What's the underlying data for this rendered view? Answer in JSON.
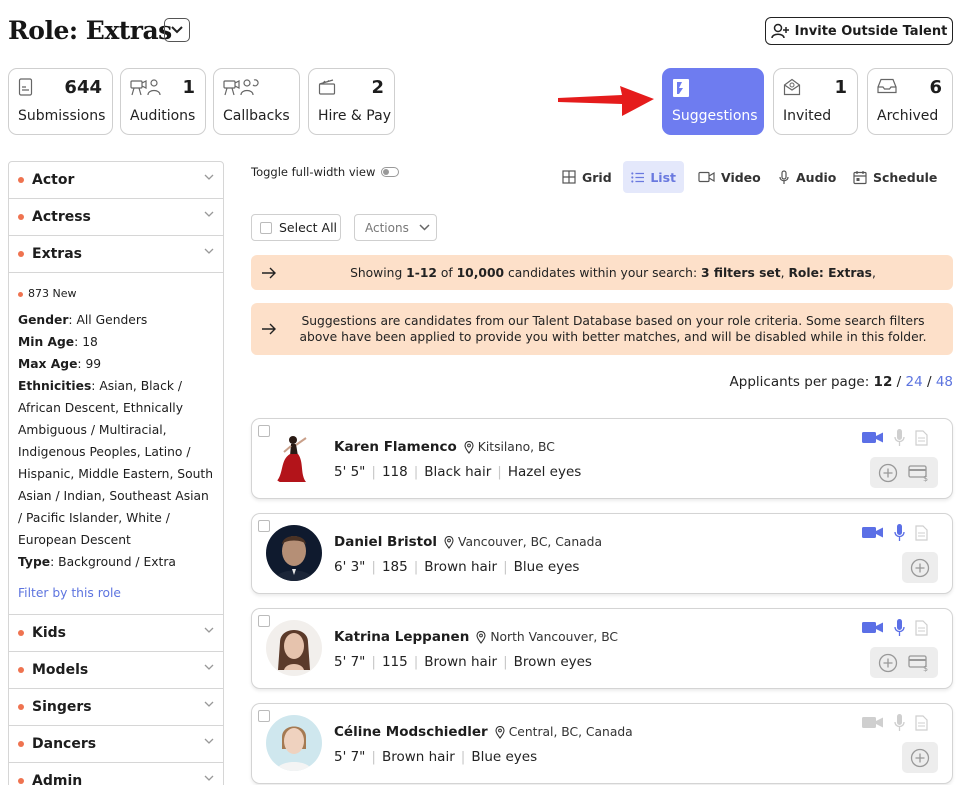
{
  "header": {
    "title": "Role: Extras",
    "invite_label": "Invite Outside Talent"
  },
  "stats": [
    {
      "label": "Submissions",
      "count": "644",
      "icon": "document-icon"
    },
    {
      "label": "Auditions",
      "count": "1",
      "icon": "camera-person-icon"
    },
    {
      "label": "Callbacks",
      "count": "",
      "icon": "camera-callback-icon"
    },
    {
      "label": "Hire & Pay",
      "count": "2",
      "icon": "clapperboard-icon"
    },
    {
      "label": "Suggestions",
      "count": "",
      "icon": "brand-b-icon"
    },
    {
      "label": "Invited",
      "count": "1",
      "icon": "envelope-icon"
    },
    {
      "label": "Archived",
      "count": "6",
      "icon": "inbox-icon"
    }
  ],
  "sidebar": {
    "categories_top": [
      "Actor",
      "Actress",
      "Extras"
    ],
    "categories_bottom": [
      "Kids",
      "Models",
      "Singers",
      "Dancers",
      "Admin"
    ],
    "role": {
      "new_label": "873 New",
      "gender_label": "Gender",
      "gender_value": ": All Genders",
      "min_age_label": "Min Age",
      "min_age_value": ": 18",
      "max_age_label": "Max Age",
      "max_age_value": ": 99",
      "ethnicities_label": "Ethnicities",
      "ethnicities_value": ": Asian, Black / African Descent, Ethnically Ambiguous / Multiracial, Indigenous Peoples, Latino / Hispanic, Middle Eastern, South Asian / Indian, Southeast Asian / Pacific Islander, White / European Descent",
      "type_label": "Type",
      "type_value": ": Background / Extra",
      "filter_link": "Filter by this role"
    }
  },
  "toolbar": {
    "toggle_label": "Toggle full-width view",
    "views": [
      "Grid",
      "List",
      "Video",
      "Audio",
      "Schedule"
    ],
    "active_view": "List",
    "select_all_label": "Select All",
    "actions_label": "Actions"
  },
  "banners": {
    "results_prefix": "Showing ",
    "results_range": "1-12",
    "results_of": " of ",
    "results_total": "10,000",
    "results_mid": " candidates within your search:  ",
    "results_filters": "3 filters set",
    "results_sep": ",  ",
    "results_role": "Role: Extras",
    "results_end": ",",
    "suggestions_text": "Suggestions are candidates from our Talent Database based on your role criteria. Some search filters above have been applied to provide you with better matches, and will be disabled while in this folder."
  },
  "pagination": {
    "label": "Applicants per page: ",
    "current": "12",
    "sep": " / ",
    "opt24": "24",
    "opt48": "48"
  },
  "candidates": [
    {
      "name": "Karen Flamenco",
      "location": "Kitsilano, BC",
      "attrs": [
        "5' 5\"",
        "118",
        "Black hair",
        "Hazel eyes"
      ]
    },
    {
      "name": "Daniel Bristol",
      "location": "Vancouver, BC, Canada",
      "attrs": [
        "6' 3\"",
        "185",
        "Brown hair",
        "Blue eyes"
      ]
    },
    {
      "name": "Katrina Leppanen",
      "location": "North Vancouver, BC",
      "attrs": [
        "5' 7\"",
        "115",
        "Brown hair",
        "Brown eyes"
      ]
    },
    {
      "name": "Céline Modschiedler",
      "location": "Central, BC, Canada",
      "attrs": [
        "5' 7\"",
        "Brown hair",
        "Blue eyes"
      ]
    }
  ],
  "colors": {
    "accent": "#6e7cf0",
    "banner": "#fde0c9",
    "dot": "#ef7350",
    "link": "#5d74df",
    "arrow": "#e51c1c"
  }
}
